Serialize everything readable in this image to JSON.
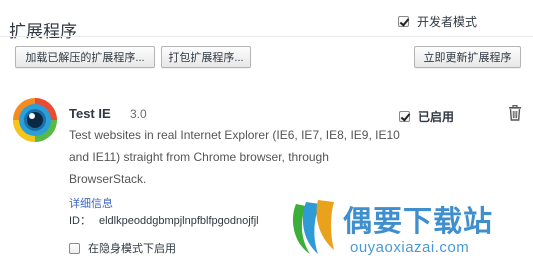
{
  "header": {
    "title": "扩展程序",
    "developer_mode_label": "开发者模式",
    "developer_mode_checked": true
  },
  "toolbar": {
    "load_unpacked_label": "加载已解压的扩展程序...",
    "pack_label": "打包扩展程序...",
    "update_now_label": "立即更新扩展程序"
  },
  "extension": {
    "icon": "browserstack-eye-icon",
    "name": "Test IE",
    "version": "3.0",
    "description": "Test websites in real Internet Explorer (IE6, IE7, IE8, IE9, IE10 and IE11) straight from Chrome browser, through BrowserStack.",
    "details_link": "详细信息",
    "id_label": "ID：",
    "id_value": "eldlkpeoddgbmpjlnpfblfpgodnojfjl",
    "incognito_label": "在隐身模式下启用",
    "incognito_checked": false,
    "enabled_label": "已启用",
    "enabled_checked": true,
    "remove_icon": "trash-icon"
  },
  "watermark": {
    "title": "偶要下载站",
    "url": "ouyaoxiazai.com"
  },
  "colors": {
    "link": "#3b66c4",
    "watermark": "#3f8fce"
  }
}
